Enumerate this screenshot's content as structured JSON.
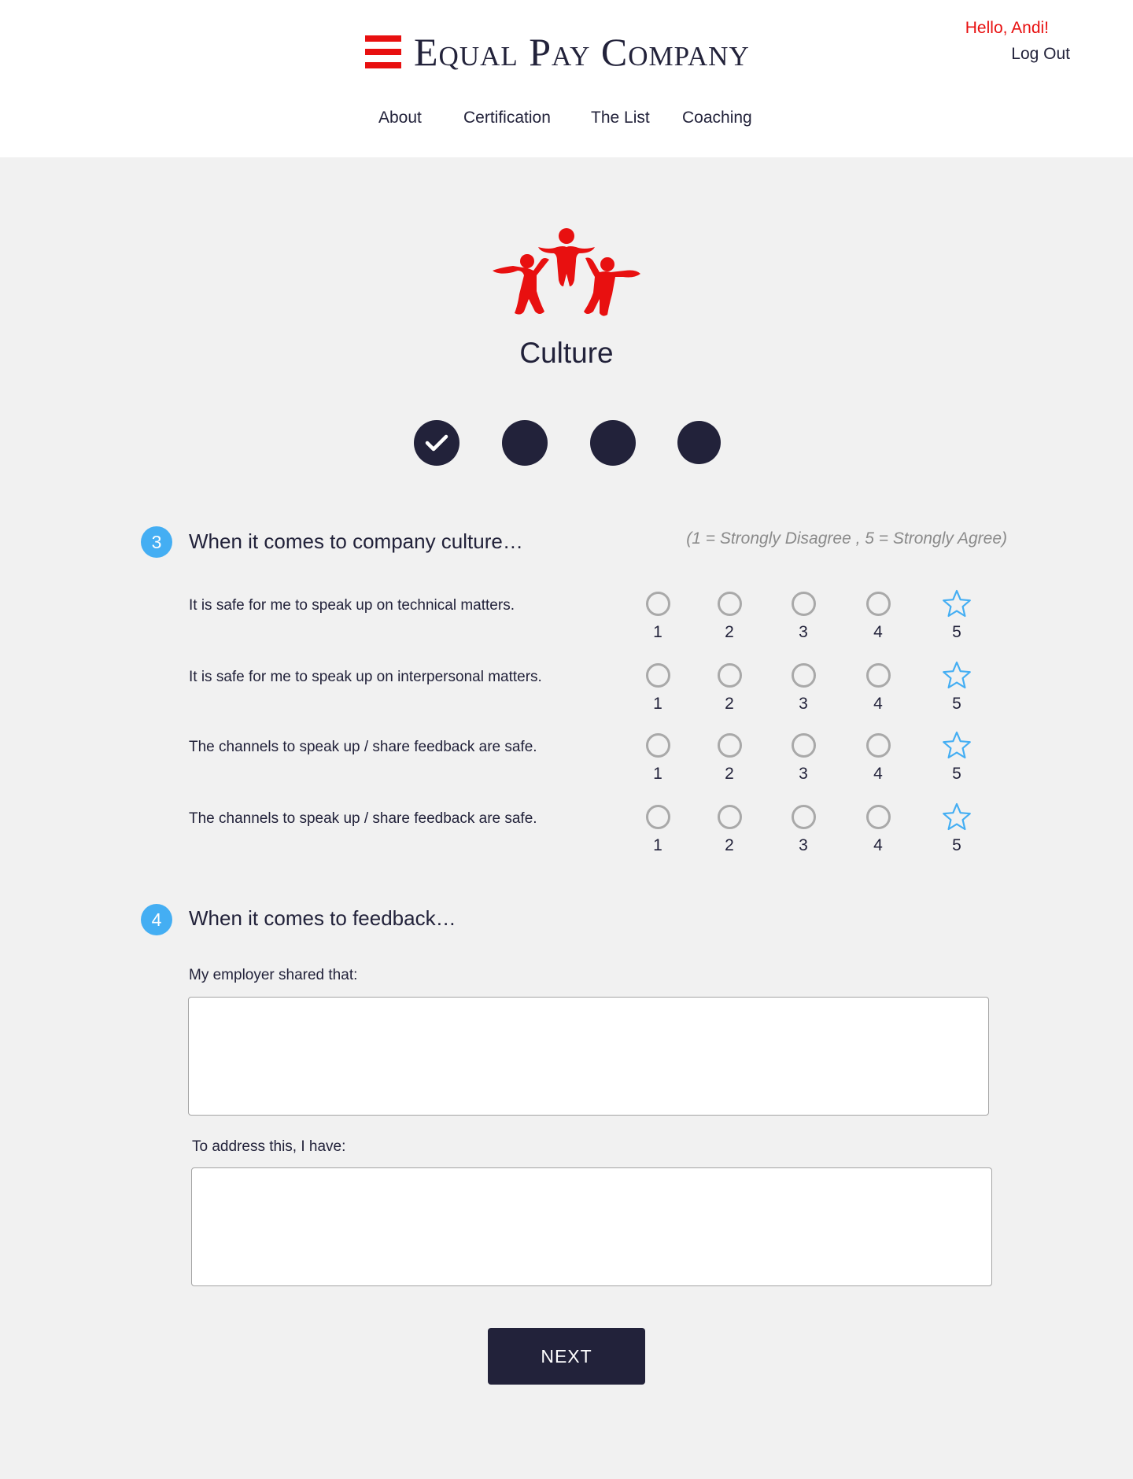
{
  "header": {
    "brand": "Equal Pay Company",
    "greeting": "Hello, Andi!",
    "logout": "Log Out",
    "nav": [
      "About",
      "Certification",
      "The List",
      "Coaching"
    ]
  },
  "section": {
    "title": "Culture",
    "icon": "people-celebrating-icon",
    "steps": [
      {
        "state": "complete",
        "icon": "check-icon"
      },
      {
        "state": "incomplete"
      },
      {
        "state": "incomplete"
      },
      {
        "state": "incomplete"
      }
    ]
  },
  "question3": {
    "number": "3",
    "title": "When it comes to company culture…",
    "scale_note": "(1 = Strongly Disagree , 5 = Strongly Agree)",
    "options": [
      "1",
      "2",
      "3",
      "4",
      "5"
    ],
    "statements": [
      {
        "text": "It is safe for me to speak up on technical matters.",
        "selected": "5"
      },
      {
        "text": "It is safe for me to speak up on interpersonal matters.",
        "selected": "5"
      },
      {
        "text": "The channels to speak up / share feedback are safe.",
        "selected": "5"
      },
      {
        "text": "The channels to speak up / share feedback are safe.",
        "selected": "5"
      }
    ]
  },
  "question4": {
    "number": "4",
    "title": "When it comes to feedback…",
    "field1_label": "My employer shared that:",
    "field1_value": "",
    "field2_label": "To address this, I have:",
    "field2_value": ""
  },
  "next_label": "NEXT",
  "colors": {
    "brand_red": "#e81010",
    "navy": "#22223a",
    "accent_blue": "#44aef3",
    "background": "#f1f1f1"
  }
}
